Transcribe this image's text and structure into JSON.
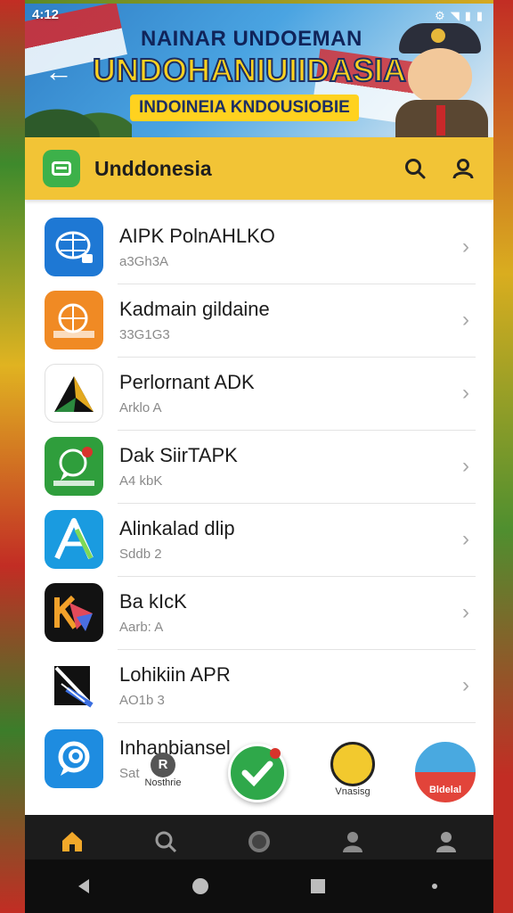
{
  "status_bar": {
    "time": "4:12"
  },
  "banner": {
    "line1": "NAINAR UNDOEMAN",
    "line2": "UNDOHANIUIIDASIA",
    "line3": "INDOINEIA KNDOUSIOBIE"
  },
  "header": {
    "title": "Unddonesia"
  },
  "apps": [
    {
      "name": "AIPK PolnAHLKO",
      "sub": "a3Gh3A",
      "icon_color": "#1e78d4",
      "icon": "link-globe"
    },
    {
      "name": "Kadmain gildaine",
      "sub": "33G1G3",
      "icon_color": "#f08a24",
      "icon": "globe"
    },
    {
      "name": "Perlornant ADK",
      "sub": "Arklo A",
      "icon_color": "#ffffff",
      "icon": "triangle"
    },
    {
      "name": "Dak SiirTAPK",
      "sub": "A4 kbK",
      "icon_color": "#2f9e3c",
      "icon": "chat"
    },
    {
      "name": "Alinkalad dlip",
      "sub": "Sddb 2",
      "icon_color": "#1a9be0",
      "icon": "letter-a"
    },
    {
      "name": "Ba kIcK",
      "sub": "Aarb: A",
      "icon_color": "#121212",
      "icon": "k-arrow"
    },
    {
      "name": "Lohikiin APR",
      "sub": "AO1b 3",
      "icon_color": "#ffffff",
      "icon": "slash"
    },
    {
      "name": "Inhanbiansel",
      "sub": "Sat",
      "icon_color": "#1e8ce0",
      "icon": "chat-ring"
    }
  ],
  "floaters": [
    {
      "label": "Nosthrie",
      "color": "#555555"
    },
    {
      "label": "",
      "color": "#2fa84a"
    },
    {
      "label": "Vnasisg",
      "color": "#f2c92e"
    },
    {
      "label": "Bldelal",
      "color": "#e2443a"
    }
  ]
}
